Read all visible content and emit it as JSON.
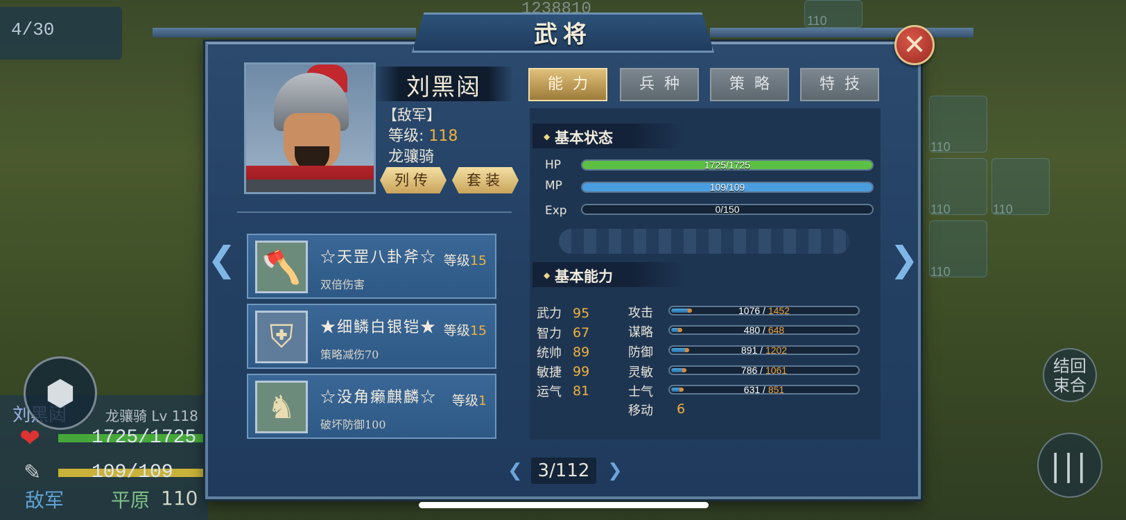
{
  "background": {
    "turn": "4/30",
    "gold": "1238810",
    "tile_levels": [
      "110",
      "110",
      "110",
      "110",
      "110"
    ],
    "unit_info": {
      "name": "刘黑闼",
      "class_level": "龙骧骑 Lv 118",
      "hp": "1725/1725",
      "mp": "109/109",
      "faction": "敌军",
      "terrain": "平原",
      "terrain_value": "110"
    },
    "end_turn_label": "结回\n束合",
    "menu_icon": "cube-icon",
    "more_icon": "pillars-icon"
  },
  "dialog": {
    "title": "武将",
    "close_icon": "close-x-icon"
  },
  "hero": {
    "name": "刘黑闼",
    "faction": "【敌军】",
    "level_label": "等级:",
    "level_value": "118",
    "class": "龙骧骑",
    "biography_button": "列传",
    "set_button": "套装"
  },
  "equipment": [
    {
      "name": "☆天罡八卦斧☆",
      "level_label": "等级",
      "level": "15",
      "effect": "双倍伤害",
      "icon": "axe-icon"
    },
    {
      "name": "★细鳞白银铠★",
      "level_label": "等级",
      "level": "15",
      "effect": "策略减伤70",
      "icon": "armor-icon"
    },
    {
      "name": "☆没角癞麒麟☆",
      "level_label": "等级",
      "level": "1",
      "effect": "破坏防御100",
      "icon": "horse-icon"
    }
  ],
  "tabs": [
    {
      "label": "能力",
      "active": true
    },
    {
      "label": "兵种",
      "active": false
    },
    {
      "label": "策略",
      "active": false
    },
    {
      "label": "特技",
      "active": false
    }
  ],
  "basic_status": {
    "title": "基本状态",
    "bars": [
      {
        "label": "HP",
        "text": "1725/1725",
        "fraction": 1.0,
        "color": "#5cc045"
      },
      {
        "label": "MP",
        "text": "109/109",
        "fraction": 1.0,
        "color": "#4a9ee0"
      },
      {
        "label": "Exp",
        "text": "0/150",
        "fraction": 0.0,
        "color": "#c9a13a"
      }
    ]
  },
  "basic_ability": {
    "title": "基本能力",
    "attributes": [
      {
        "name": "武力",
        "value": "95"
      },
      {
        "name": "智力",
        "value": "67"
      },
      {
        "name": "统帅",
        "value": "89"
      },
      {
        "name": "敏捷",
        "value": "99"
      },
      {
        "name": "运气",
        "value": "81"
      }
    ],
    "stats": [
      {
        "name": "攻击",
        "current": "1076",
        "max": "1452"
      },
      {
        "name": "谋略",
        "current": "480",
        "max": "648"
      },
      {
        "name": "防御",
        "current": "891",
        "max": "1202"
      },
      {
        "name": "灵敏",
        "current": "786",
        "max": "1061"
      },
      {
        "name": "士气",
        "current": "631",
        "max": "851"
      }
    ],
    "move_label": "移动",
    "move_value": "6"
  },
  "pager": {
    "text": "3/112"
  }
}
